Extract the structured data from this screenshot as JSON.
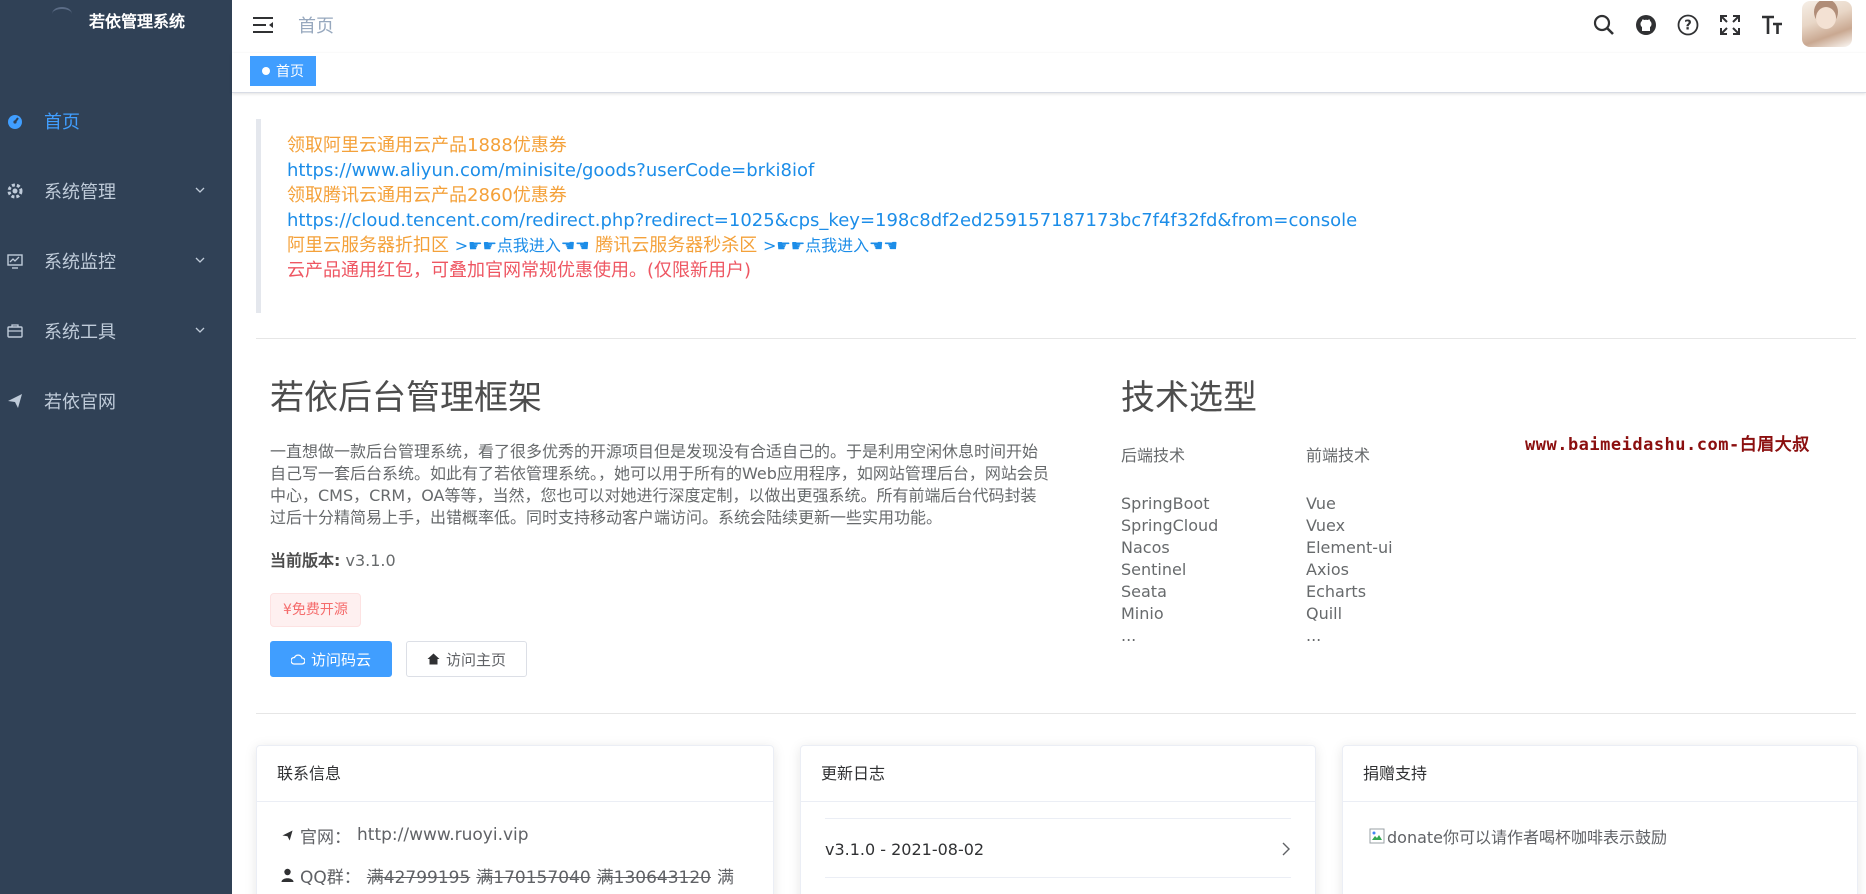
{
  "sidebar": {
    "title": "若依管理系统",
    "items": [
      {
        "label": "首页",
        "icon": "dashboard-icon",
        "active": true
      },
      {
        "label": "系统管理",
        "icon": "gear-icon"
      },
      {
        "label": "系统监控",
        "icon": "monitor-icon"
      },
      {
        "label": "系统工具",
        "icon": "toolbox-icon"
      },
      {
        "label": "若依官网",
        "icon": "send-icon"
      }
    ]
  },
  "header": {
    "breadcrumb": "首页",
    "icons": [
      "search-icon",
      "github-icon",
      "help-icon",
      "fullscreen-icon",
      "font-size-icon"
    ]
  },
  "tags": {
    "active": "首页"
  },
  "notice": {
    "line1": "领取阿里云通用云产品1888优惠券",
    "line2": "https://www.aliyun.com/minisite/goods?userCode=brki8iof",
    "line3": "领取腾讯云通用云产品2860优惠券",
    "line4": "https://cloud.tencent.com/redirect.php?redirect=1025&cps_key=198c8df2ed259157187173bc7f4f32fd&from=console",
    "line5a": "阿里云服务器折扣区",
    "line5b": ">☛☛点我进入☚☚",
    "line5c": "腾讯云服务器秒杀区",
    "line5d": ">☛☛点我进入☚☚",
    "line6": "云产品通用红包，可叠加官网常规优惠使用。(仅限新用户)"
  },
  "intro": {
    "title": "若依后台管理框架",
    "description": "一直想做一款后台管理系统，看了很多优秀的开源项目但是发现没有合适自己的。于是利用空闲休息时间开始自己写一套后台系统。如此有了若依管理系统。，她可以用于所有的Web应用程序，如网站管理后台，网站会员中心，CMS，CRM，OA等等，当然，您也可以对她进行深度定制，以做出更强系统。所有前端后台代码封装过后十分精简易上手，出错概率低。同时支持移动客户端访问。系统会陆续更新一些实用功能。",
    "version_label": "当前版本:",
    "version": "v3.1.0",
    "badge": "¥免费开源",
    "btn_gitee": "访问码云",
    "btn_home": "访问主页"
  },
  "tech": {
    "title": "技术选型",
    "backend_title": "后端技术",
    "backend": [
      "SpringBoot",
      "SpringCloud",
      "Nacos",
      "Sentinel",
      "Seata",
      "Minio",
      "..."
    ],
    "frontend_title": "前端技术",
    "frontend": [
      "Vue",
      "Vuex",
      "Element-ui",
      "Axios",
      "Echarts",
      "Quill",
      "..."
    ]
  },
  "watermark": "www.baimeidashu.com-白眉大叔",
  "cards": {
    "contact": {
      "title": "联系信息",
      "site_label": "官网：",
      "site": "http://www.ruoyi.vip",
      "qq_label": "QQ群：",
      "qq1": "满42799195",
      "qq2": "满170157040",
      "qq3": "满130643120",
      "qq4": "满"
    },
    "log": {
      "title": "更新日志",
      "entry": "v3.1.0 - 2021-08-02"
    },
    "donate": {
      "title": "捐赠支持",
      "text": "donate你可以请作者喝杯咖啡表示鼓励"
    }
  }
}
